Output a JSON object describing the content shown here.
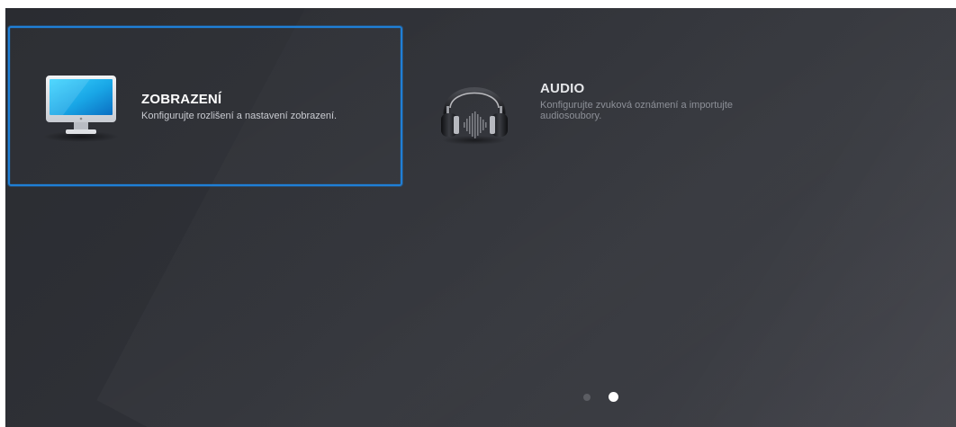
{
  "tiles": [
    {
      "title": "ZOBRAZENÍ",
      "description": "Konfigurujte rozlišení a nastavení zobrazení.",
      "icon": "monitor-icon",
      "selected": true
    },
    {
      "title": "AUDIO",
      "description": "Konfigurujte zvuková oznámení a importujte audiosoubory.",
      "icon": "headphones-icon",
      "selected": false
    }
  ],
  "pager": {
    "pages": 2,
    "current": 2
  },
  "colors": {
    "selection_border": "#1f7fd6",
    "background": "#2f3137"
  }
}
